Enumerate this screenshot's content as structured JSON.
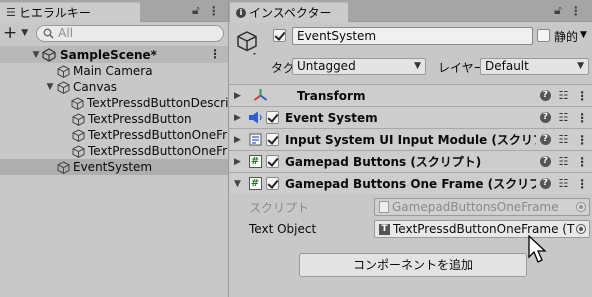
{
  "hierarchy": {
    "tab_title": "ヒエラルキー",
    "search_placeholder": "All",
    "scene_name": "SampleScene*",
    "items": [
      {
        "label": "Main Camera"
      },
      {
        "label": "Canvas"
      },
      {
        "label": "TextPressdButtonDescri"
      },
      {
        "label": "TextPressdButton"
      },
      {
        "label": "TextPressdButtonOneFr"
      },
      {
        "label": "TextPressdButtonOneFr"
      },
      {
        "label": "EventSystem"
      }
    ]
  },
  "inspector": {
    "tab_title": "インスペクター",
    "object_name": "EventSystem",
    "static_label": "静的",
    "tag_label": "タグ",
    "tag_value": "Untagged",
    "layer_label": "レイヤー",
    "layer_value": "Default",
    "components": [
      {
        "name": "Transform",
        "has_checkbox": false,
        "icon": "transform-icon"
      },
      {
        "name": "Event System",
        "has_checkbox": true,
        "icon": "event-system-icon"
      },
      {
        "name": "Input System UI Input Module (スクリプ",
        "has_checkbox": true,
        "icon": "input-module-icon"
      },
      {
        "name": "Gamepad Buttons (スクリプト)",
        "has_checkbox": true,
        "icon": "script-icon"
      },
      {
        "name": "Gamepad Buttons One Frame (スクリプト",
        "has_checkbox": true,
        "icon": "script-icon"
      }
    ],
    "script_label": "スクリプト",
    "script_value": "GamepadButtonsOneFrame",
    "text_object_label": "Text Object",
    "text_object_value": "TextPressdButtonOneFrame (T",
    "add_component_label": "コンポーネントを追加"
  },
  "colors": {
    "panel_bg": "#c8c8c8",
    "tab_bar": "#a5a5a5",
    "selected_row": "#aeaeae",
    "transform_red": "#d53b3b",
    "transform_green": "#2f9e3a",
    "transform_blue": "#2d5fd0"
  }
}
